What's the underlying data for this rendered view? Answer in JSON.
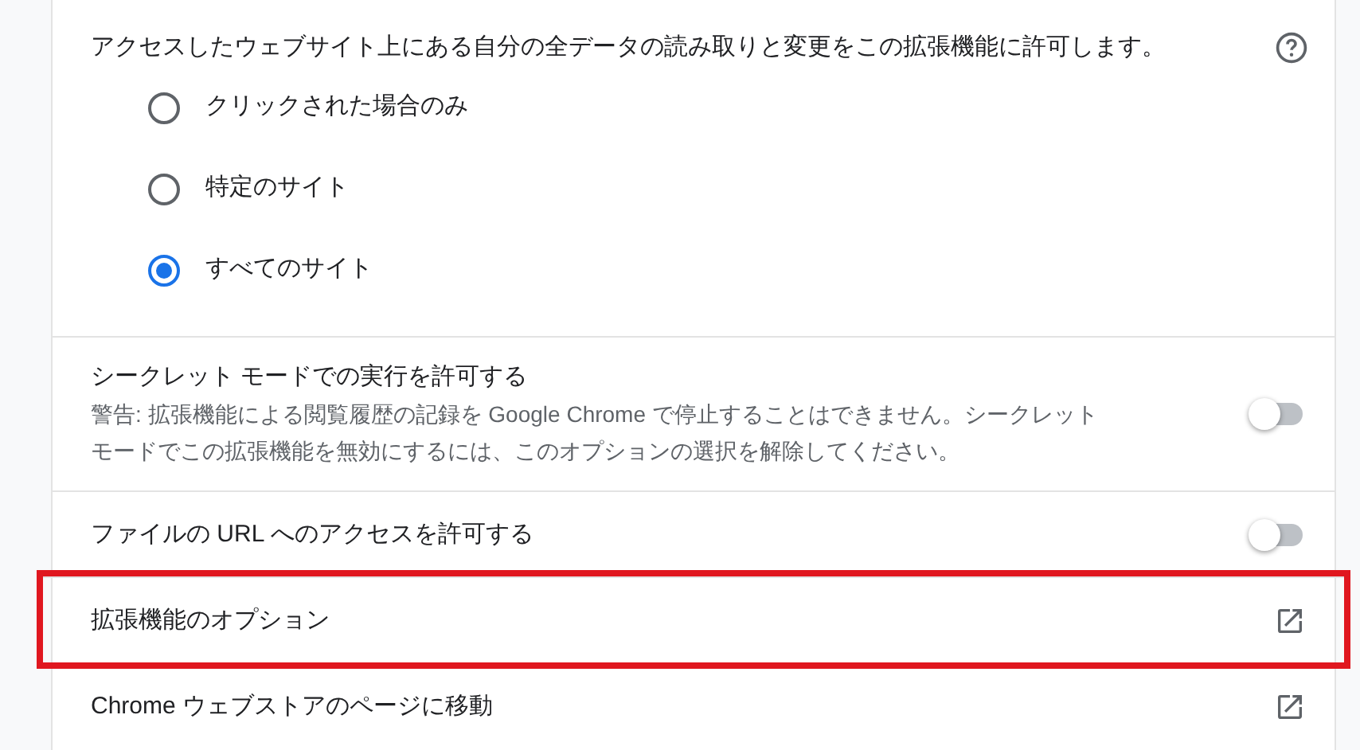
{
  "site_access": {
    "label": "アクセスしたウェブサイト上にある自分の全データの読み取りと変更をこの拡張機能に許可します。",
    "options": [
      {
        "label": "クリックされた場合のみ",
        "selected": false
      },
      {
        "label": "特定のサイト",
        "selected": false
      },
      {
        "label": "すべてのサイト",
        "selected": true
      }
    ]
  },
  "rows": [
    {
      "kind": "toggle",
      "title": "シークレット モードでの実行を許可する",
      "description": "警告: 拡張機能による閲覧履歴の記録を Google Chrome で停止することはできません。シークレットモードでこの拡張機能を無効にするには、このオプションの選択を解除してください。",
      "on": false,
      "highlighted": false
    },
    {
      "kind": "toggle",
      "title": "ファイルの URL へのアクセスを許可する",
      "on": false,
      "highlighted": false
    },
    {
      "kind": "link",
      "title": "拡張機能のオプション",
      "highlighted": true
    },
    {
      "kind": "link",
      "title": "Chrome ウェブストアのページに移動",
      "highlighted": false
    }
  ]
}
